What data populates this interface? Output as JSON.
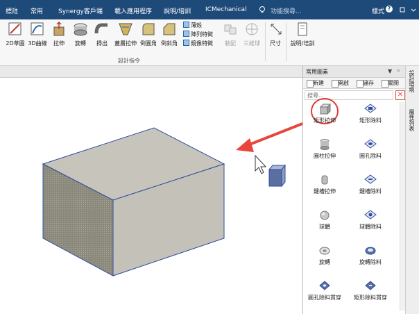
{
  "titlebar": {
    "tabs": [
      "標註",
      "常用",
      "Synergy客戶端",
      "載入應用程序",
      "說明/培訓",
      "ICMechanical"
    ],
    "search_placeholder": "功能搜尋...",
    "style_label": "樣式",
    "help_glyph": "?"
  },
  "ribbon": {
    "buttons": [
      "2D草圖",
      "3D曲線",
      "拉伸",
      "旋轉",
      "掃出",
      "蓋層拉伸",
      "倒圓角",
      "倒斜角"
    ],
    "small_buttons": [
      "薄殼",
      "陣列特徵",
      "鏡像特徵"
    ],
    "disabled_buttons": [
      "裝配",
      "三維球"
    ],
    "other_buttons": [
      "尺寸",
      "說明/培訓"
    ],
    "group_label": "設計指令"
  },
  "panel": {
    "title": "常用圖素",
    "pin_glyphs": [
      "▼",
      "ᵖ"
    ],
    "toolbar": [
      "新建",
      "開啟",
      "儲存",
      "關閉"
    ],
    "search_placeholder": "搜尋...",
    "close_glyph": "✕",
    "items": [
      "矩形拉伸",
      "矩形除料",
      "圓柱拉伸",
      "圓孔除料",
      "鍵槽拉伸",
      "鍵槽除料",
      "球體",
      "球體除料",
      "旋轉",
      "旋轉除料",
      "圓孔除料貫穿",
      "矩形除料貫穿"
    ]
  },
  "side_tabs": [
    "設計環境",
    "屬性列表"
  ],
  "colors": {
    "titlebar": "#1e4a7a",
    "highlight_circle": "#e03a35",
    "arrow": "#e8453c",
    "box_top": "#c7c5bb",
    "box_front": "#8f8c80",
    "box_edge": "#2f4c9e"
  }
}
